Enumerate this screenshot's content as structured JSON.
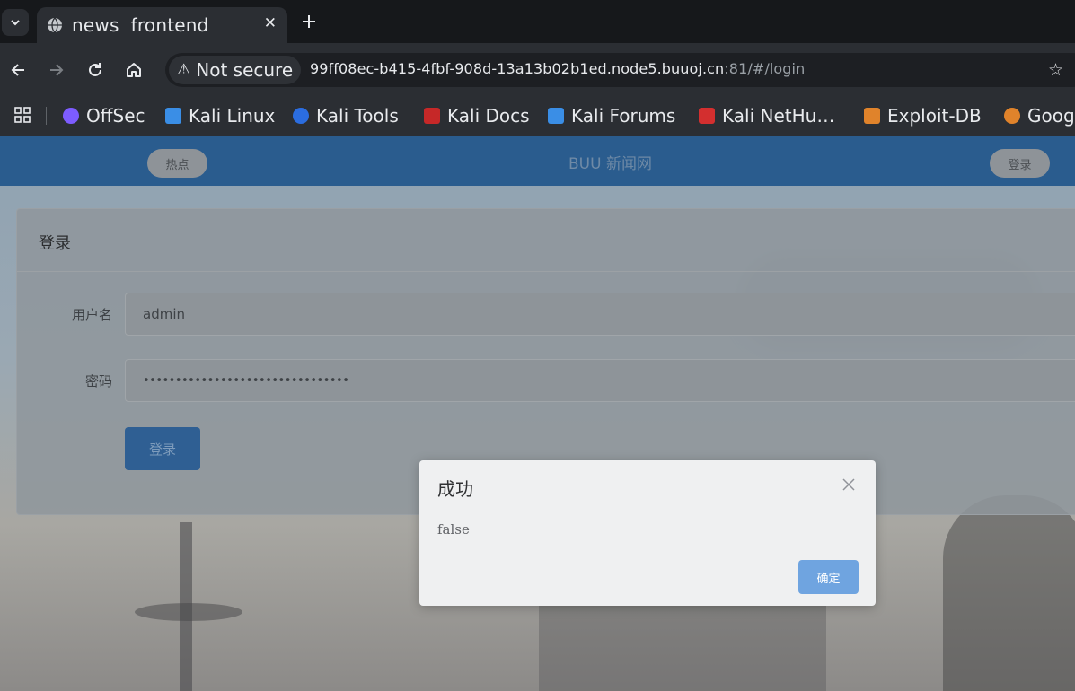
{
  "browser": {
    "tab": {
      "title": "news  frontend",
      "close_glyph": "✕",
      "favicon": "globe-icon"
    },
    "new_tab_glyph": "+",
    "security_label": "Not secure",
    "url": {
      "host": "99ff08ec-b415-4fbf-908d-13a13b02b1ed.node5.buuoj.cn",
      "rest": ":81/#/login"
    },
    "bookmarks": [
      {
        "label": "OffSec",
        "color": "#7d5cff"
      },
      {
        "label": "Kali Linux",
        "color": "#3a8ee6"
      },
      {
        "label": "Kali Tools",
        "color": "#2b6de0"
      },
      {
        "label": "Kali Docs",
        "color": "#c62828"
      },
      {
        "label": "Kali Forums",
        "color": "#3a8ee6"
      },
      {
        "label": "Kali NetHu…",
        "color": "#d32f2f"
      },
      {
        "label": "Exploit-DB",
        "color": "#e0832b"
      },
      {
        "label": "Goog",
        "color": "#e0832b"
      }
    ]
  },
  "site": {
    "hot_button": "热点",
    "title": "BUU 新闻网",
    "login_button": "登录"
  },
  "login_form": {
    "title": "登录",
    "username_label": "用户名",
    "username_value": "admin",
    "password_label": "密码",
    "password_value": "••••••••••••••••••••••••••••••••",
    "submit_label": "登录"
  },
  "dialog": {
    "title": "成功",
    "message": "false",
    "confirm_label": "确定"
  },
  "colors": {
    "header_blue": "#2a5c8e",
    "dialog_button": "#6fa4e0"
  }
}
